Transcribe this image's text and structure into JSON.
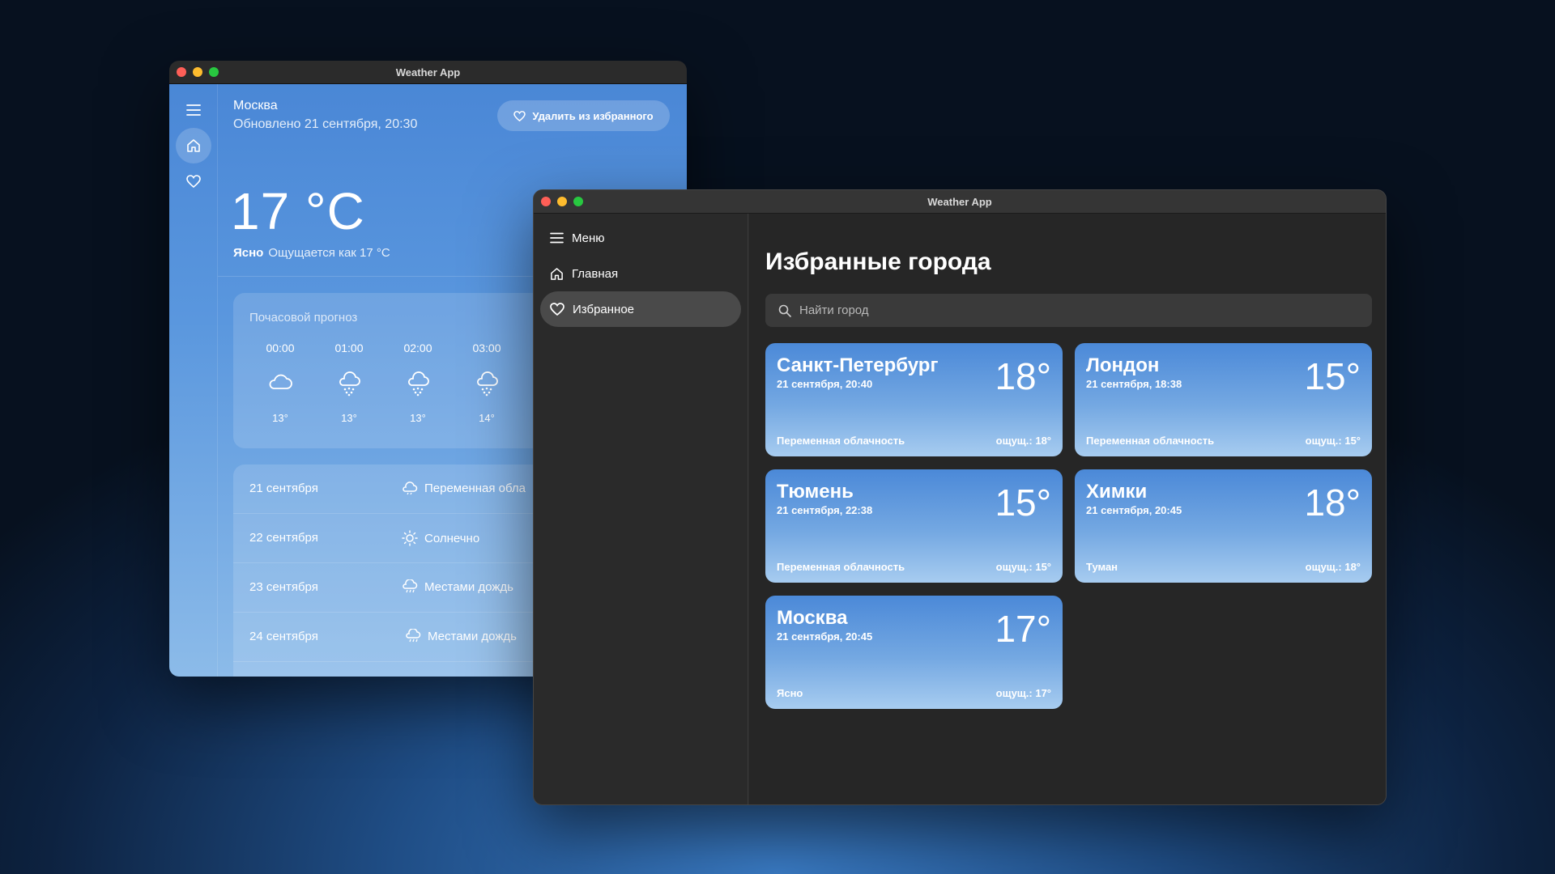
{
  "back_window": {
    "title": "Weather App",
    "city": "Москва",
    "updated": "Обновлено 21 сентября, 20:30",
    "remove_fav_label": "Удалить из избранного",
    "temperature": "17 °C",
    "condition": "Ясно",
    "feels_like": "Ощущается как 17 °C",
    "hourly": {
      "title": "Почасовой прогноз",
      "items": [
        {
          "time": "00:00",
          "icon": "cloud-icon",
          "temp": "13°"
        },
        {
          "time": "01:00",
          "icon": "snow-icon",
          "temp": "13°"
        },
        {
          "time": "02:00",
          "icon": "snow-icon",
          "temp": "13°"
        },
        {
          "time": "03:00",
          "icon": "snow-icon",
          "temp": "14°"
        }
      ]
    },
    "daily": [
      {
        "date": "21 сентября",
        "icon": "partly-cloudy-icon",
        "condition": "Переменная обла"
      },
      {
        "date": "22 сентября",
        "icon": "sun-icon",
        "condition": "Солнечно"
      },
      {
        "date": "23 сентября",
        "icon": "rain-icon",
        "condition": "Местами дождь"
      },
      {
        "date": "24 сентября",
        "icon": "rain-icon",
        "condition": "Местами дождь"
      }
    ]
  },
  "front_window": {
    "title": "Weather App",
    "sidebar": {
      "items": [
        {
          "label": "Меню",
          "icon": "menu-icon"
        },
        {
          "label": "Главная",
          "icon": "home-icon"
        },
        {
          "label": "Избранное",
          "icon": "heart-icon",
          "active": true
        }
      ]
    },
    "page_title": "Избранные города",
    "search": {
      "placeholder": "Найти город",
      "value": ""
    },
    "cities": [
      {
        "name": "Санкт-Петербург",
        "date": "21 сентября, 20:40",
        "temp": "18°",
        "condition": "Переменная облачность",
        "feels": "ощущ.: 18°"
      },
      {
        "name": "Лондон",
        "date": "21 сентября, 18:38",
        "temp": "15°",
        "condition": "Переменная облачность",
        "feels": "ощущ.: 15°"
      },
      {
        "name": "Тюмень",
        "date": "21 сентября, 22:38",
        "temp": "15°",
        "condition": "Переменная облачность",
        "feels": "ощущ.: 15°"
      },
      {
        "name": "Химки",
        "date": "21 сентября, 20:45",
        "temp": "18°",
        "condition": "Туман",
        "feels": "ощущ.: 18°"
      },
      {
        "name": "Москва",
        "date": "21 сентября, 20:45",
        "temp": "17°",
        "condition": "Ясно",
        "feels": "ощущ.: 17°"
      }
    ]
  }
}
